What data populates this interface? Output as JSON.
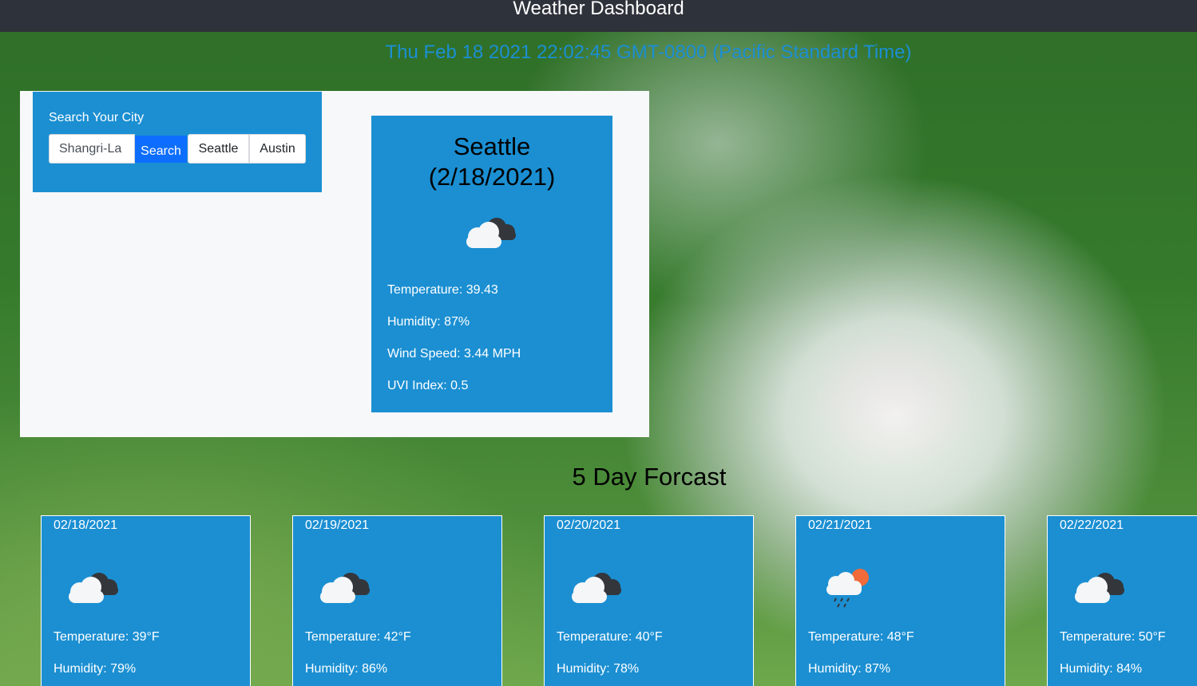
{
  "header": {
    "title": "Weather Dashboard"
  },
  "clock": {
    "datetime": "Thu Feb 18 2021 22:02:45 GMT-0800 (Pacific Standard Time)"
  },
  "search": {
    "label": "Search Your City",
    "input_value": "Shangri-La",
    "button_label": "Search",
    "history": [
      "Seattle",
      "Austin"
    ]
  },
  "current": {
    "city": "Seattle",
    "date": "(2/18/2021)",
    "icon": "broken-clouds-icon",
    "temperature": "Temperature: 39.43",
    "humidity": "Humidity: 87%",
    "wind_speed": "Wind Speed: 3.44 MPH",
    "uv_index": "UVI Index: 0.5"
  },
  "forecast": {
    "heading": "5 Day Forcast",
    "days": [
      {
        "date": "02/18/2021",
        "icon": "broken-clouds-icon",
        "temperature": "Temperature: 39°F",
        "humidity": "Humidity: 79%"
      },
      {
        "date": "02/19/2021",
        "icon": "broken-clouds-icon",
        "temperature": "Temperature: 42°F",
        "humidity": "Humidity: 86%"
      },
      {
        "date": "02/20/2021",
        "icon": "broken-clouds-icon",
        "temperature": "Temperature: 40°F",
        "humidity": "Humidity: 78%"
      },
      {
        "date": "02/21/2021",
        "icon": "rain-sun-icon",
        "temperature": "Temperature: 48°F",
        "humidity": "Humidity: 87%"
      },
      {
        "date": "02/22/2021",
        "icon": "broken-clouds-icon",
        "temperature": "Temperature: 50°F",
        "humidity": "Humidity: 84%"
      }
    ]
  },
  "colors": {
    "card_blue": "#1b8fd2",
    "clock_blue": "#1b8fd2",
    "navbar": "#2e323a",
    "search_button": "#0d6efd"
  }
}
